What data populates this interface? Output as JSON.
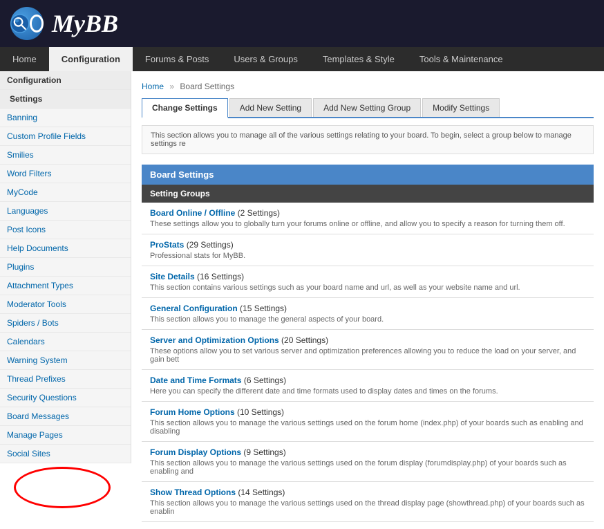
{
  "logo": {
    "text": "MyBB"
  },
  "nav": {
    "items": [
      {
        "label": "Home",
        "active": false
      },
      {
        "label": "Configuration",
        "active": true
      },
      {
        "label": "Forums & Posts",
        "active": false
      },
      {
        "label": "Users & Groups",
        "active": false
      },
      {
        "label": "Templates & Style",
        "active": false
      },
      {
        "label": "Tools & Maintenance",
        "active": false
      }
    ]
  },
  "sidebar": {
    "section": "Configuration",
    "subsection": "Settings",
    "items": [
      {
        "label": "Banning"
      },
      {
        "label": "Custom Profile Fields"
      },
      {
        "label": "Smilies"
      },
      {
        "label": "Word Filters"
      },
      {
        "label": "MyCode"
      },
      {
        "label": "Languages"
      },
      {
        "label": "Post Icons"
      },
      {
        "label": "Help Documents"
      },
      {
        "label": "Plugins"
      },
      {
        "label": "Attachment Types"
      },
      {
        "label": "Moderator Tools"
      },
      {
        "label": "Spiders / Bots"
      },
      {
        "label": "Calendars"
      },
      {
        "label": "Warning System"
      },
      {
        "label": "Thread Prefixes"
      },
      {
        "label": "Security Questions"
      },
      {
        "label": "Board Messages"
      },
      {
        "label": "Manage Pages"
      },
      {
        "label": "Social Sites"
      }
    ]
  },
  "breadcrumb": {
    "home": "Home",
    "separator": "»",
    "current": "Board Settings"
  },
  "tabs": [
    {
      "label": "Change Settings",
      "active": true
    },
    {
      "label": "Add New Setting",
      "active": false
    },
    {
      "label": "Add New Setting Group",
      "active": false
    },
    {
      "label": "Modify Settings",
      "active": false
    }
  ],
  "info_text": "This section allows you to manage all of the various settings relating to your board. To begin, select a group below to manage settings re",
  "board_settings": {
    "title": "Board Settings",
    "subheader": "Setting Groups",
    "groups": [
      {
        "title": "Board Online / Offline",
        "count": "(2 Settings)",
        "desc": "These settings allow you to globally turn your forums online or offline, and allow you to specify a reason for turning them off."
      },
      {
        "title": "ProStats",
        "count": "(29 Settings)",
        "desc": "Professional stats for MyBB."
      },
      {
        "title": "Site Details",
        "count": "(16 Settings)",
        "desc": "This section contains various settings such as your board name and url, as well as your website name and url."
      },
      {
        "title": "General Configuration",
        "count": "(15 Settings)",
        "desc": "This section allows you to manage the general aspects of your board."
      },
      {
        "title": "Server and Optimization Options",
        "count": "(20 Settings)",
        "desc": "These options allow you to set various server and optimization preferences allowing you to reduce the load on your server, and gain bett"
      },
      {
        "title": "Date and Time Formats",
        "count": "(6 Settings)",
        "desc": "Here you can specify the different date and time formats used to display dates and times on the forums."
      },
      {
        "title": "Forum Home Options",
        "count": "(10 Settings)",
        "desc": "This section allows you to manage the various settings used on the forum home (index.php) of your boards such as enabling and disabling"
      },
      {
        "title": "Forum Display Options",
        "count": "(9 Settings)",
        "desc": "This section allows you to manage the various settings used on the forum display (forumdisplay.php) of your boards such as enabling and"
      },
      {
        "title": "Show Thread Options",
        "count": "(14 Settings)",
        "desc": "This section allows you to manage the various settings used on the thread display page (showthread.php) of your boards such as enablin"
      }
    ]
  }
}
